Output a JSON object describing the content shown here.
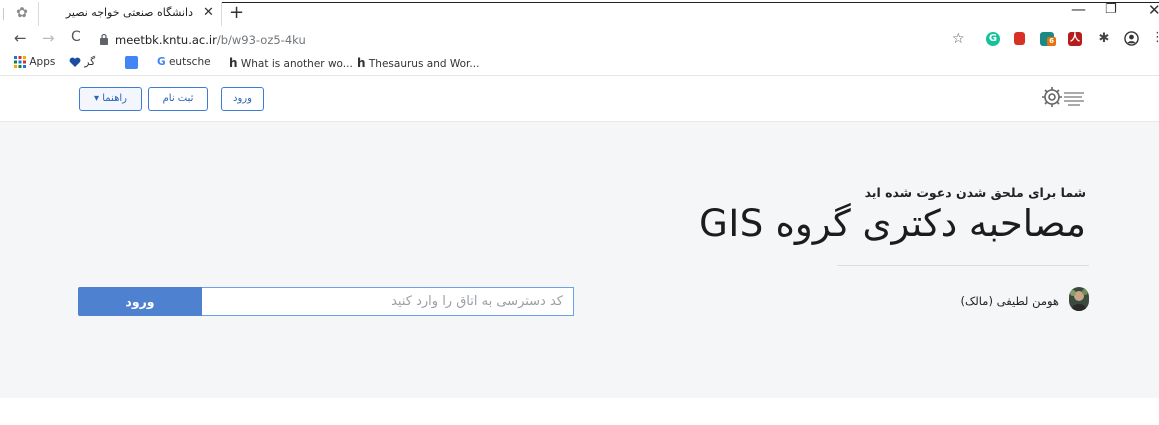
{
  "browser": {
    "tab": {
      "title": "دانشگاه صنعتی خواجه نصیر",
      "close": "✕"
    },
    "new_tab": "+",
    "window_controls": {
      "minimize": "—",
      "maximize": "❐",
      "close": "✕"
    },
    "nav": {
      "back": "←",
      "forward": "→",
      "reload": "C"
    },
    "address": {
      "domain": "meetbk.kntu.ac.ir",
      "path": "/b/w93-oz5-4ku"
    },
    "bookmark_star": "☆",
    "extensions": [
      {
        "icon": "grammarly-icon",
        "glyph": "G",
        "color": "#15c39a"
      },
      {
        "icon": "red-square-icon",
        "glyph": "",
        "color": "#d93025"
      },
      {
        "icon": "extension-badge-icon",
        "glyph": "6",
        "color": "#1a8a87"
      },
      {
        "icon": "pdf-icon",
        "glyph": "人",
        "color": "#b71c1c"
      }
    ],
    "puzzle": "✱",
    "menu": "⋮",
    "bookmarks": [
      {
        "label": "Apps"
      },
      {
        "label": "گر"
      },
      {
        "label": ""
      },
      {
        "label": "eutsche"
      },
      {
        "label": "What is another wo..."
      },
      {
        "label": "Thesaurus and Wor..."
      }
    ]
  },
  "header": {
    "help_label": "راهنما ▾",
    "signup_label": "ثبت نام",
    "login_label": "ورود"
  },
  "room": {
    "invite_text": "شما برای ملحق شدن دعوت شده اید",
    "title": "مصاحبه دکتری گروه GIS",
    "owner": "هومن لطیفی (مالک)",
    "code_placeholder": "کد دسترسی به اتاق را وارد کنید",
    "enter_label": "ورود"
  },
  "colors": {
    "accent": "#4e81d0",
    "background": "#f5f6f8"
  }
}
